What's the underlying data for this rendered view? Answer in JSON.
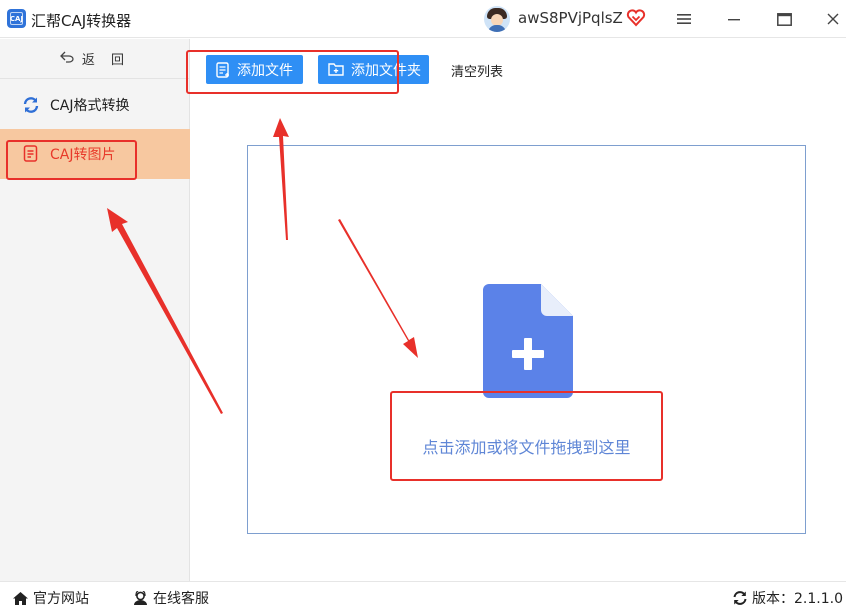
{
  "titlebar": {
    "app_name": "汇帮CAJ转换器",
    "logo_text": "CAJ",
    "username": "awS8PVjPqlsZ",
    "icons": [
      "app-logo",
      "avatar",
      "vip-heart-icon",
      "menu-icon",
      "minimize-icon",
      "maximize-icon",
      "close-icon"
    ]
  },
  "sidebar": {
    "back_label": "返 回",
    "items": [
      {
        "label": "CAJ格式转换",
        "icon": "refresh-icon",
        "active": false
      },
      {
        "label": "CAJ转图片",
        "icon": "document-icon",
        "active": true
      }
    ]
  },
  "toolbar": {
    "add_file_label": "添加文件",
    "add_folder_label": "添加文件夹",
    "clear_label": "清空列表"
  },
  "dropzone": {
    "hint": "点击添加或将文件拖拽到这里",
    "icon": "file-plus-icon"
  },
  "statusbar": {
    "website_label": "官方网站",
    "service_label": "在线客服",
    "version_label": "版本：2.1.1.0"
  },
  "colors": {
    "primary_button": "#2f8ff5",
    "active_item_bg": "#f7c8a0",
    "active_item_text": "#e83a2a",
    "annotation_red": "#e8302a",
    "dropzone_border": "#7e9fcf",
    "dropzone_icon": "#5b82e8"
  }
}
